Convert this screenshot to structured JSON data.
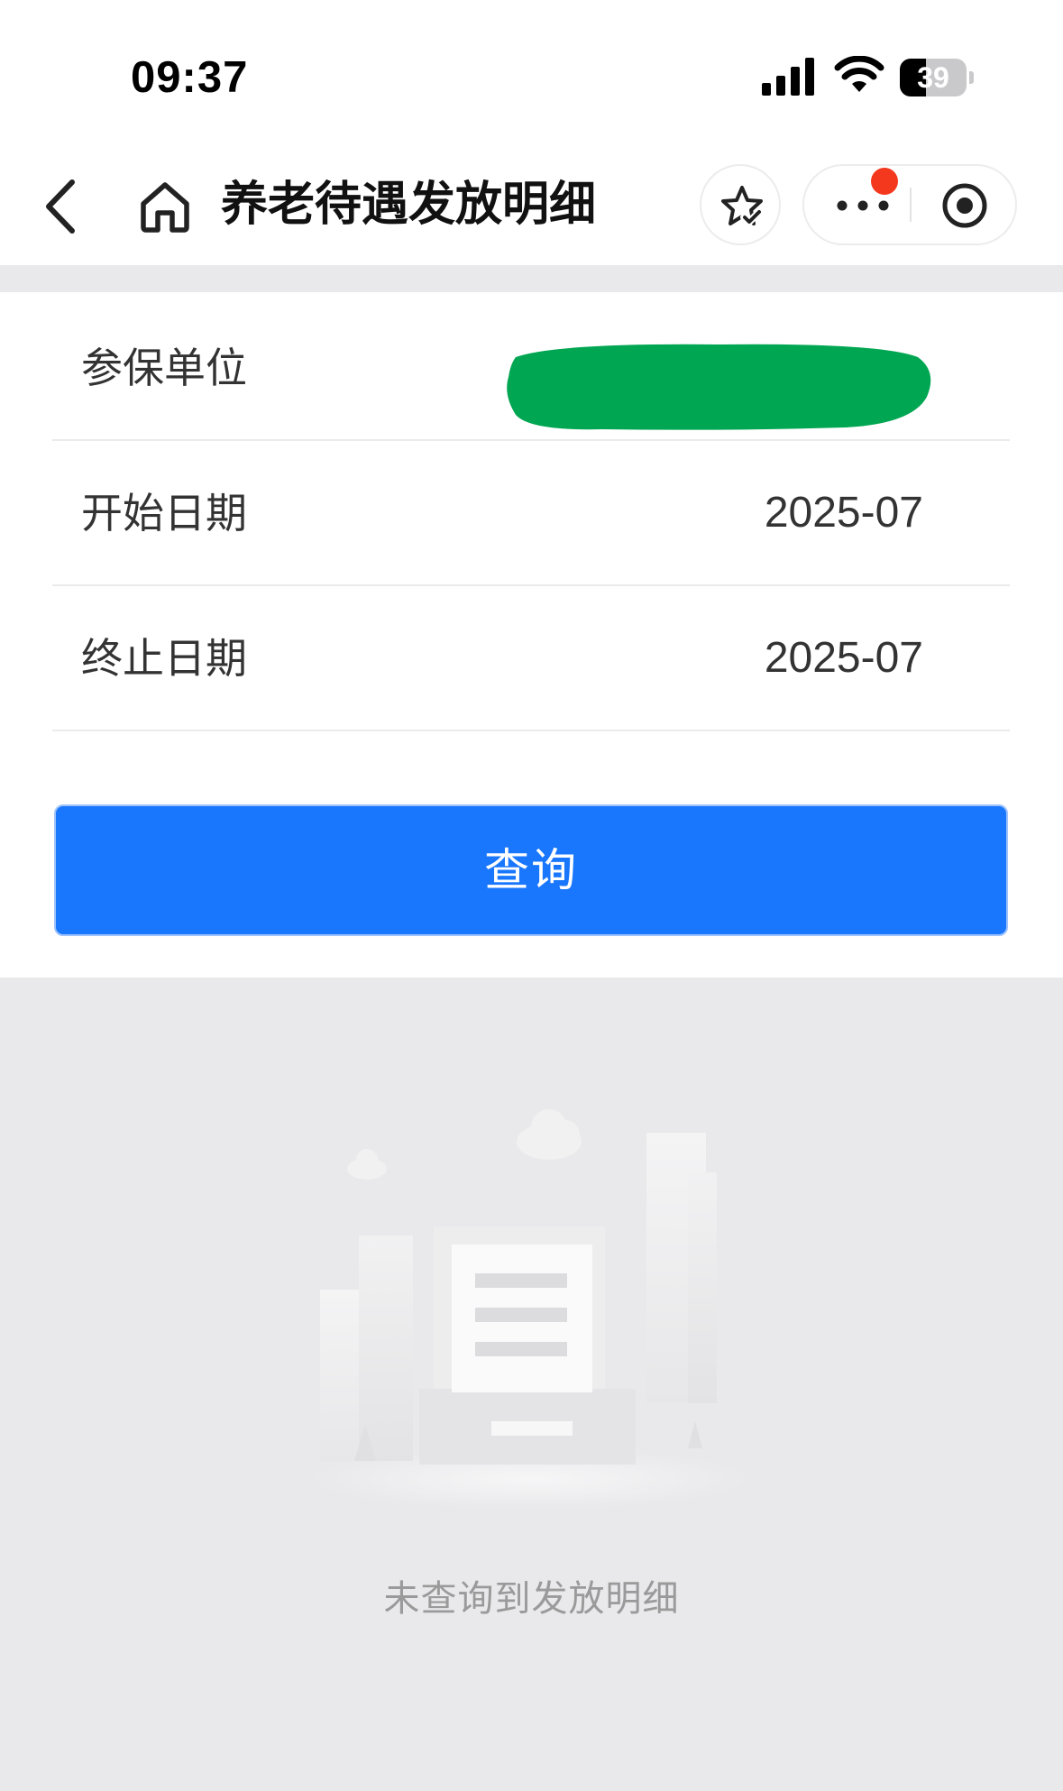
{
  "status_bar": {
    "time": "09:37",
    "battery_level": "39",
    "battery_fraction": 0.39
  },
  "nav": {
    "title": "养老待遇发放明细",
    "icons": [
      "back-icon",
      "home-icon",
      "favorite-star-icon",
      "more-icon",
      "close-target-icon"
    ]
  },
  "form": {
    "unit_label": "参保单位",
    "unit_value_redacted": true,
    "start_label": "开始日期",
    "start_value": "2025-07",
    "end_label": "终止日期",
    "end_value": "2025-07",
    "query_label": "查询"
  },
  "empty_state": {
    "message": "未查询到发放明细"
  },
  "colors": {
    "primary": "#1977fd",
    "redaction": "#00a651",
    "notification_dot": "#f4381e",
    "page_background": "#e9e9eb"
  }
}
